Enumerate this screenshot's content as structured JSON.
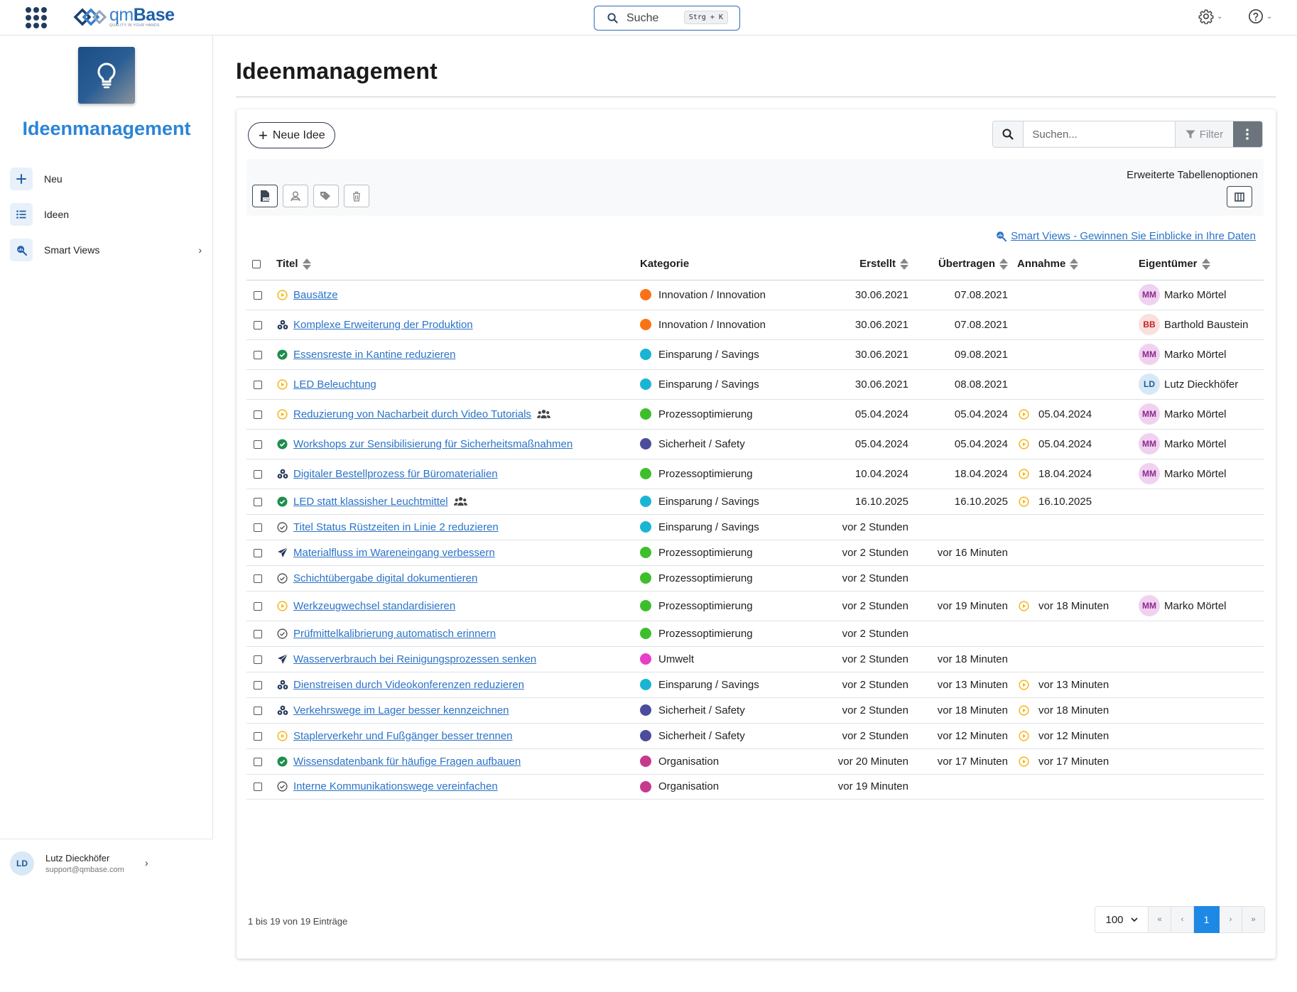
{
  "brand": {
    "name_prefix": "qm",
    "name_suffix": "Base",
    "tagline": "QUALITY IN YOUR HANDS"
  },
  "topbar": {
    "search_label": "Suche",
    "search_shortcut": "Strg + K"
  },
  "sidebar": {
    "app_title": "Ideenmanagement",
    "items": [
      {
        "label": "Neu",
        "icon": "plus-icon"
      },
      {
        "label": "Ideen",
        "icon": "list-icon"
      },
      {
        "label": "Smart Views",
        "icon": "search-chart-icon"
      }
    ],
    "user": {
      "initials": "LD",
      "name": "Lutz Dieckhöfer",
      "email": "support@qmbase.com"
    }
  },
  "main": {
    "page_title": "Ideenmanagement",
    "new_button": "Neue Idee",
    "search_placeholder": "Suchen...",
    "filter_label": "Filter",
    "advanced_options": "Erweiterte Tabellenoptionen",
    "smart_views_link": "Smart Views - Gewinnen Sie Einblicke in Ihre Daten",
    "table": {
      "headers": {
        "title": "Titel",
        "category": "Kategorie",
        "created": "Erstellt",
        "transferred": "Übertragen",
        "accepted": "Annahme",
        "owner": "Eigentümer"
      },
      "rows": [
        {
          "status": "play",
          "title": "Bausätze",
          "team": false,
          "category": "Innovation / Innovation",
          "cat_color": "#f97316",
          "created": "30.06.2021",
          "transferred": "07.08.2021",
          "accepted": "",
          "owner_initials": "MM",
          "owner": "Marko Mörtel",
          "owner_kind": "mm"
        },
        {
          "status": "cluster",
          "title": "Komplexe Erweiterung der Produktion",
          "team": false,
          "category": "Innovation / Innovation",
          "cat_color": "#f97316",
          "created": "30.06.2021",
          "transferred": "07.08.2021",
          "accepted": "",
          "owner_initials": "BB",
          "owner": "Barthold Baustein",
          "owner_kind": "bb"
        },
        {
          "status": "check",
          "title": "Essensreste in Kantine reduzieren",
          "team": false,
          "category": "Einsparung / Savings",
          "cat_color": "#1ab5d4",
          "created": "30.06.2021",
          "transferred": "09.08.2021",
          "accepted": "",
          "owner_initials": "MM",
          "owner": "Marko Mörtel",
          "owner_kind": "mm"
        },
        {
          "status": "play",
          "title": "LED Beleuchtung",
          "team": false,
          "category": "Einsparung / Savings",
          "cat_color": "#1ab5d4",
          "created": "30.06.2021",
          "transferred": "08.08.2021",
          "accepted": "",
          "owner_initials": "LD",
          "owner": "Lutz Dieckhöfer",
          "owner_kind": "ld"
        },
        {
          "status": "play",
          "title": "Reduzierung von Nacharbeit durch Video Tutorials",
          "team": true,
          "category": "Prozessoptimierung",
          "cat_color": "#3dbf2c",
          "created": "05.04.2024",
          "transferred": "05.04.2024",
          "accepted": "05.04.2024",
          "owner_initials": "MM",
          "owner": "Marko Mörtel",
          "owner_kind": "mm"
        },
        {
          "status": "check",
          "title": "Workshops zur Sensibilisierung für Sicherheitsmaßnahmen",
          "team": false,
          "category": "Sicherheit / Safety",
          "cat_color": "#4b4c9a",
          "created": "05.04.2024",
          "transferred": "05.04.2024",
          "accepted": "05.04.2024",
          "owner_initials": "MM",
          "owner": "Marko Mörtel",
          "owner_kind": "mm"
        },
        {
          "status": "cluster",
          "title": "Digitaler Bestellprozess für Büromaterialien",
          "team": false,
          "category": "Prozessoptimierung",
          "cat_color": "#3dbf2c",
          "created": "10.04.2024",
          "transferred": "18.04.2024",
          "accepted": "18.04.2024",
          "owner_initials": "MM",
          "owner": "Marko Mörtel",
          "owner_kind": "mm"
        },
        {
          "status": "check",
          "title": "LED statt klassisher Leuchtmittel",
          "team": true,
          "category": "Einsparung / Savings",
          "cat_color": "#1ab5d4",
          "created": "16.10.2025",
          "transferred": "16.10.2025",
          "accepted": "16.10.2025",
          "owner_initials": "",
          "owner": "",
          "owner_kind": ""
        },
        {
          "status": "draft",
          "title": "Titel Status Rüstzeiten in Linie 2 reduzieren",
          "team": false,
          "category": "Einsparung / Savings",
          "cat_color": "#1ab5d4",
          "created": "vor 2 Stunden",
          "transferred": "",
          "accepted": "",
          "owner_initials": "",
          "owner": "",
          "owner_kind": ""
        },
        {
          "status": "send",
          "title": "Materialfluss im Wareneingang verbessern",
          "team": false,
          "category": "Prozessoptimierung",
          "cat_color": "#3dbf2c",
          "created": "vor 2 Stunden",
          "transferred": "vor 16 Minuten",
          "accepted": "",
          "owner_initials": "",
          "owner": "",
          "owner_kind": ""
        },
        {
          "status": "draft",
          "title": "Schichtübergabe digital dokumentieren",
          "team": false,
          "category": "Prozessoptimierung",
          "cat_color": "#3dbf2c",
          "created": "vor 2 Stunden",
          "transferred": "",
          "accepted": "",
          "owner_initials": "",
          "owner": "",
          "owner_kind": ""
        },
        {
          "status": "play",
          "title": "Werkzeugwechsel standardisieren",
          "team": false,
          "category": "Prozessoptimierung",
          "cat_color": "#3dbf2c",
          "created": "vor 2 Stunden",
          "transferred": "vor 19 Minuten",
          "accepted": "vor 18 Minuten",
          "owner_initials": "MM",
          "owner": "Marko Mörtel",
          "owner_kind": "mm"
        },
        {
          "status": "draft",
          "title": "Prüfmittelkalibrierung automatisch erinnern",
          "team": false,
          "category": "Prozessoptimierung",
          "cat_color": "#3dbf2c",
          "created": "vor 2 Stunden",
          "transferred": "",
          "accepted": "",
          "owner_initials": "",
          "owner": "",
          "owner_kind": ""
        },
        {
          "status": "send",
          "title": "Wasserverbrauch bei Reinigungsprozessen senken",
          "team": false,
          "category": "Umwelt",
          "cat_color": "#e83ec9",
          "created": "vor 2 Stunden",
          "transferred": "vor 18 Minuten",
          "accepted": "",
          "owner_initials": "",
          "owner": "",
          "owner_kind": ""
        },
        {
          "status": "cluster",
          "title": "Dienstreisen durch Videokonferenzen reduzieren",
          "team": false,
          "category": "Einsparung / Savings",
          "cat_color": "#1ab5d4",
          "created": "vor 2 Stunden",
          "transferred": "vor 13 Minuten",
          "accepted": "vor 13 Minuten",
          "owner_initials": "",
          "owner": "",
          "owner_kind": ""
        },
        {
          "status": "cluster",
          "title": "Verkehrswege im Lager besser kennzeichnen",
          "team": false,
          "category": "Sicherheit / Safety",
          "cat_color": "#4b4c9a",
          "created": "vor 2 Stunden",
          "transferred": "vor 18 Minuten",
          "accepted": "vor 18 Minuten",
          "owner_initials": "",
          "owner": "",
          "owner_kind": ""
        },
        {
          "status": "play",
          "title": "Staplerverkehr und Fußgänger besser trennen",
          "team": false,
          "category": "Sicherheit / Safety",
          "cat_color": "#4b4c9a",
          "created": "vor 2 Stunden",
          "transferred": "vor 12 Minuten",
          "accepted": "vor 12 Minuten",
          "owner_initials": "",
          "owner": "",
          "owner_kind": ""
        },
        {
          "status": "check",
          "title": "Wissensdatenbank für häufige Fragen aufbauen",
          "team": false,
          "category": "Organisation",
          "cat_color": "#c63a8e",
          "created": "vor 20 Minuten",
          "transferred": "vor 17 Minuten",
          "accepted": "vor 17 Minuten",
          "owner_initials": "",
          "owner": "",
          "owner_kind": ""
        },
        {
          "status": "draft",
          "title": "Interne Kommunikationswege vereinfachen",
          "team": false,
          "category": "Organisation",
          "cat_color": "#c63a8e",
          "created": "vor 19 Minuten",
          "transferred": "",
          "accepted": "",
          "owner_initials": "",
          "owner": "",
          "owner_kind": ""
        }
      ]
    },
    "footer_info": "1 bis 19 von 19 Einträge",
    "pagination": {
      "page_size": "100",
      "first": "«",
      "prev": "‹",
      "current": "1",
      "next": "›",
      "last": "»"
    }
  }
}
